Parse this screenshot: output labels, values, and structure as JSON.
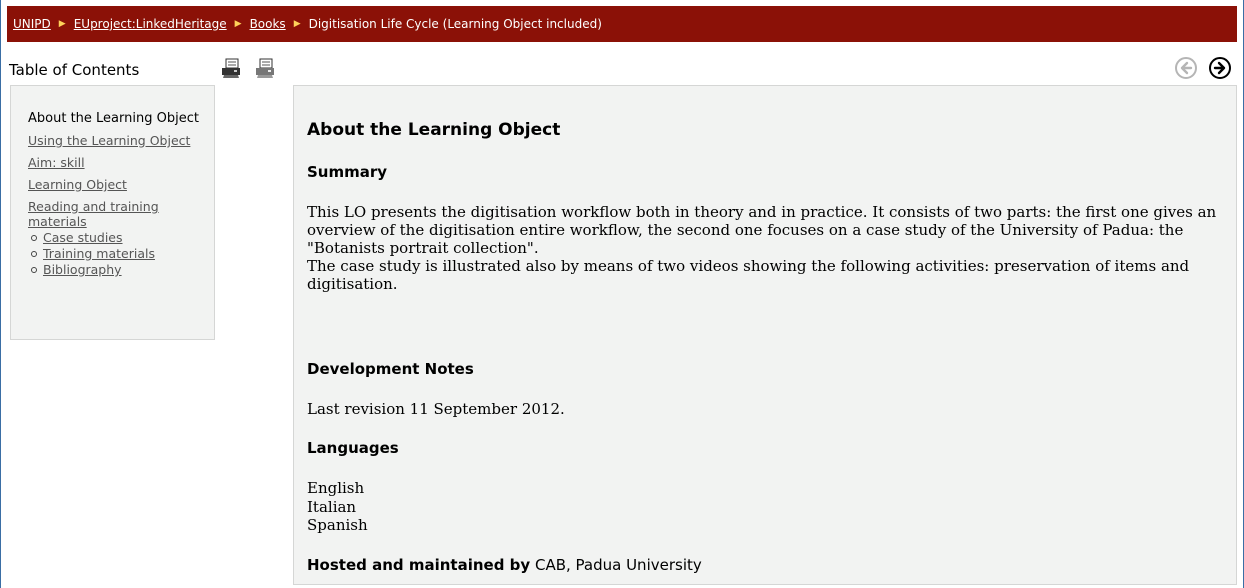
{
  "breadcrumb": {
    "items": [
      {
        "label": "UNIPD"
      },
      {
        "label": "EUproject:LinkedHeritage"
      },
      {
        "label": "Books"
      }
    ],
    "current": "Digitisation Life Cycle (Learning Object included)",
    "separator_color": "#ffd25a",
    "bar_color": "#8b1107"
  },
  "toc": {
    "title": "Table of Contents",
    "icons": [
      "print-chapter-icon",
      "print-book-icon"
    ],
    "current": "About the Learning Object",
    "links": [
      "Using the Learning Object",
      "Aim: skill",
      "Learning Object",
      "Reading and training materials"
    ],
    "sublinks": [
      "Case studies",
      "Training materials",
      "Bibliography"
    ]
  },
  "nav": {
    "prev_icon": "arrow-left-circle-icon",
    "next_icon": "arrow-right-circle-icon"
  },
  "content": {
    "heading": "About the Learning Object",
    "summary_heading": "Summary",
    "summary_text_1": "This LO presents the digitisation workflow both in theory and in practice. It consists of two parts: the first one gives an overview of the digitisation entire workflow, the second one focuses on a case study of the University of Padua: the \"Botanists portrait collection\".",
    "summary_text_2": "The case study is illustrated also by means of two videos showing the following activities: preservation of items and digitisation.",
    "dev_notes_heading": "Development Notes",
    "dev_notes_text": "Last revision 11 September 2012.",
    "languages_heading": "Languages",
    "languages": [
      "English",
      "Italian",
      "Spanish"
    ],
    "hosted_label": "Hosted and maintained by",
    "hosted_value": "CAB, Padua University"
  }
}
